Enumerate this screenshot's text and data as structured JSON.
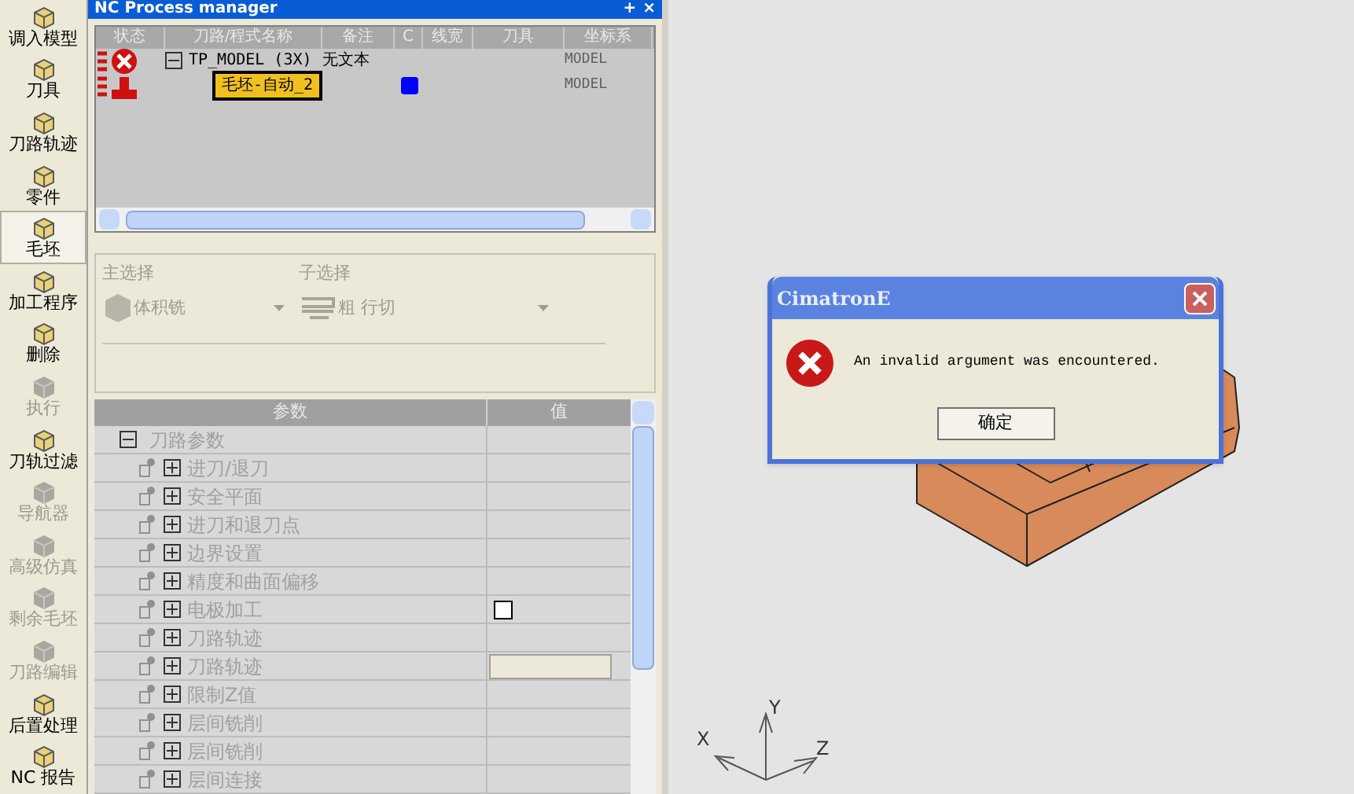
{
  "sidebar": {
    "items": [
      {
        "label": "调入模型",
        "selected": false,
        "disabled": false
      },
      {
        "label": "刀具",
        "selected": false,
        "disabled": false
      },
      {
        "label": "刀路轨迹",
        "selected": false,
        "disabled": false
      },
      {
        "label": "零件",
        "selected": false,
        "disabled": false
      },
      {
        "label": "毛坯",
        "selected": true,
        "disabled": false
      },
      {
        "label": "加工程序",
        "selected": false,
        "disabled": false
      },
      {
        "label": "删除",
        "selected": false,
        "disabled": false
      },
      {
        "label": "执行",
        "selected": false,
        "disabled": true
      },
      {
        "label": "刀轨过滤",
        "selected": false,
        "disabled": false
      },
      {
        "label": "导航器",
        "selected": false,
        "disabled": true
      },
      {
        "label": "高级仿真",
        "selected": false,
        "disabled": true
      },
      {
        "label": "剩余毛坯",
        "selected": false,
        "disabled": true
      },
      {
        "label": "刀路编辑",
        "selected": false,
        "disabled": true
      },
      {
        "label": "后置处理",
        "selected": false,
        "disabled": false
      },
      {
        "label": "NC 报告",
        "selected": false,
        "disabled": false
      }
    ]
  },
  "process_manager": {
    "title": "NC Process manager",
    "buttons": [
      "+",
      "×"
    ],
    "columns": [
      "状态",
      "刀路/程式名称",
      "备注",
      "C",
      "线宽",
      "刀具",
      "坐标系"
    ],
    "rows": [
      {
        "kind": "error",
        "expanded": true,
        "name": "TP_MODEL (3X)",
        "note": "无文本",
        "coordinate": "MODEL",
        "selected": false
      },
      {
        "kind": "normal",
        "name": "毛坯-自动_2",
        "color": "#0000ff",
        "coordinate": "MODEL",
        "selected": true
      }
    ]
  },
  "selection": {
    "main_label": "主选择",
    "main_value": "体积铣",
    "sub_label": "子选择",
    "sub_value": "粗 行切",
    "disabled": true
  },
  "parameters": {
    "columns": [
      "参数",
      "值"
    ],
    "items": [
      {
        "label": "刀路参数",
        "expanded": true,
        "children": [
          {
            "label": "进刀/退刀",
            "expanded": false
          },
          {
            "label": "安全平面",
            "expanded": false
          },
          {
            "label": "进刀和退刀点",
            "expanded": false
          },
          {
            "label": "边界设置",
            "expanded": false
          },
          {
            "label": "精度和曲面偏移",
            "expanded": false
          },
          {
            "label": "电极加工",
            "expanded": false,
            "kind": "checkbox",
            "checked": false
          },
          {
            "label": "刀路轨迹",
            "expanded": false
          },
          {
            "label": "刀路轨迹",
            "expanded": false,
            "kind": "button"
          },
          {
            "label": "限制Z值",
            "expanded": false
          },
          {
            "label": "层间铣削",
            "expanded": false
          },
          {
            "label": "层间铣削",
            "expanded": false
          },
          {
            "label": "层间连接",
            "expanded": false
          }
        ]
      }
    ]
  },
  "viewport": {
    "axes": [
      "X",
      "Y",
      "Z"
    ]
  },
  "dialog": {
    "title": "CimatronE",
    "message": "An invalid argument was encountered.",
    "button": "确定"
  }
}
